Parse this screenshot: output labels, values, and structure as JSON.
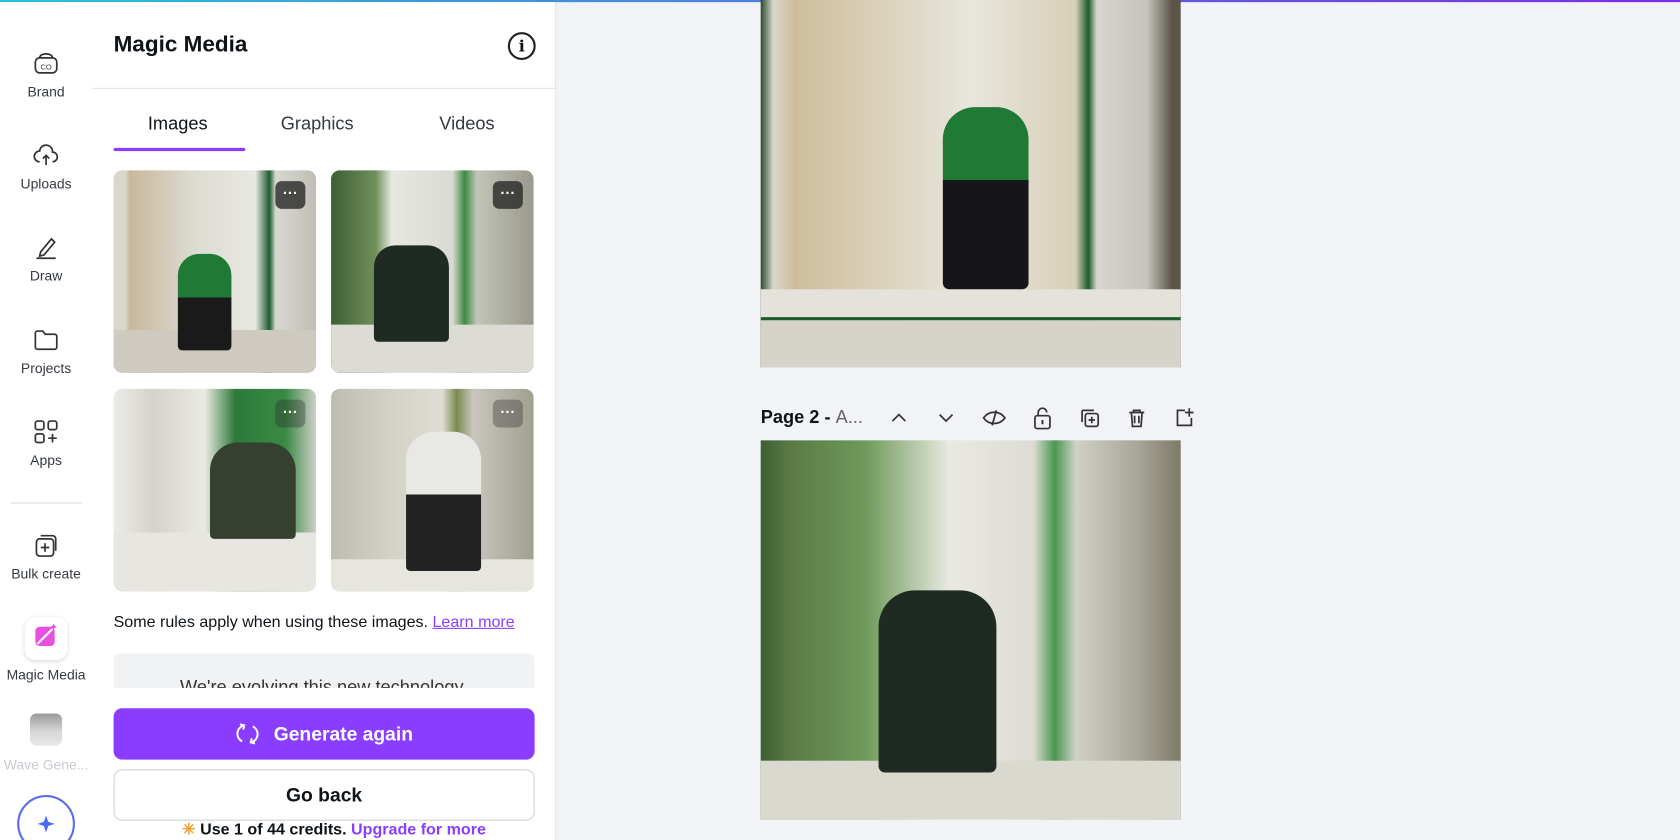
{
  "rail": {
    "items": [
      {
        "label": "Brand",
        "icon": "brand-icon"
      },
      {
        "label": "Uploads",
        "icon": "cloud-upload-icon"
      },
      {
        "label": "Draw",
        "icon": "pen-icon"
      },
      {
        "label": "Projects",
        "icon": "folder-icon"
      },
      {
        "label": "Apps",
        "icon": "apps-icon"
      },
      {
        "label": "Bulk create",
        "icon": "bulk-create-icon"
      },
      {
        "label": "Magic Media",
        "icon": "magic-media-icon"
      },
      {
        "label": "Wave Gene...",
        "icon": "wave-generator-icon"
      }
    ]
  },
  "panel": {
    "title": "Magic Media",
    "tabs": [
      {
        "label": "Images",
        "active": true
      },
      {
        "label": "Graphics"
      },
      {
        "label": "Videos"
      }
    ],
    "rules_text": "Some rules apply when using these images.",
    "learn_more": "Learn more",
    "notice": "We're evolving this new technology",
    "generate_again": "Generate again",
    "go_back": "Go back",
    "credits": "Use 1 of 44 credits.",
    "upgrade": "Upgrade for more"
  },
  "canvas": {
    "page2_label": "Page 2 -",
    "page2_title": "A..."
  },
  "colors": {
    "accent": "#8b3dff",
    "canvas_bg": "#f2f3f6"
  }
}
